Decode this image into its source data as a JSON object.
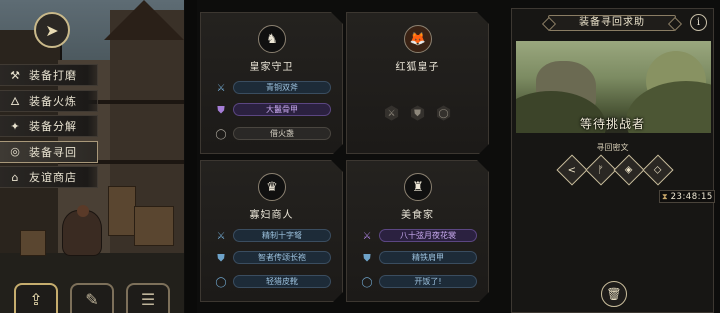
{
  "back_button": {
    "icon": "back-arrow-icon"
  },
  "sidebar": {
    "items": [
      {
        "label": "装备打磨",
        "icon": "hammer-icon",
        "glyph": "⚒",
        "active": false
      },
      {
        "label": "装备火炼",
        "icon": "flame-icon",
        "glyph": "🜂",
        "active": false
      },
      {
        "label": "装备分解",
        "icon": "break-icon",
        "glyph": "✦",
        "active": false
      },
      {
        "label": "装备寻回",
        "icon": "search-icon",
        "glyph": "◎",
        "active": true
      },
      {
        "label": "友谊商店",
        "icon": "shop-icon",
        "glyph": "⌂",
        "active": false
      }
    ]
  },
  "bottom_nav": [
    {
      "icon": "upload-box-icon",
      "glyph": "⇪",
      "active": true
    },
    {
      "icon": "quill-icon",
      "glyph": "✎",
      "active": false
    },
    {
      "icon": "list-icon",
      "glyph": "☰",
      "active": false
    }
  ],
  "cards": [
    {
      "name": "皇家守卫",
      "avatar": "royal-guard-avatar",
      "rows": [
        {
          "label": "青铜双斧",
          "style": "blue",
          "icon": "axe-icon",
          "glyph": "⚔"
        },
        {
          "label": "大鬣骨甲",
          "style": "purple",
          "icon": "armor-icon",
          "glyph": "⛊"
        },
        {
          "label": "借火盏",
          "style": "grey",
          "icon": "ring-icon",
          "glyph": "◯"
        }
      ]
    },
    {
      "name": "红狐皇子",
      "avatar": "red-fox-prince-avatar",
      "rows": [],
      "slots": [
        {
          "icon": "weapon-slot-icon",
          "glyph": "⚔"
        },
        {
          "icon": "armor-slot-icon",
          "glyph": "⛊"
        },
        {
          "icon": "ring-slot-icon",
          "glyph": "◯"
        }
      ]
    },
    {
      "name": "寡妇商人",
      "avatar": "widow-merchant-avatar",
      "rows": [
        {
          "label": "精制十字弩",
          "style": "blue",
          "icon": "crossbow-icon",
          "glyph": "⚔"
        },
        {
          "label": "智者传颂长袍",
          "style": "blue",
          "icon": "robe-icon",
          "glyph": "⛊"
        },
        {
          "label": "轻猎皮靴",
          "style": "blue",
          "icon": "boots-icon",
          "glyph": "◯"
        }
      ]
    },
    {
      "name": "美食家",
      "avatar": "gourmet-avatar",
      "rows": [
        {
          "label": "八十弦月夜花裳",
          "style": "purple",
          "icon": "dagger-icon",
          "glyph": "⚔"
        },
        {
          "label": "精铁肩甲",
          "style": "blue",
          "icon": "pauldron-icon",
          "glyph": "⛊"
        },
        {
          "label": "开饭了!",
          "style": "blue",
          "icon": "ring-icon",
          "glyph": "◯"
        }
      ]
    }
  ],
  "right_panel": {
    "title": "装备寻回求助",
    "info_icon": "info-icon",
    "status": "等待挑战者",
    "ritual_label": "寻回密文",
    "rituals": [
      {
        "icon": "rune-1-icon",
        "glyph": "<"
      },
      {
        "icon": "rune-2-icon",
        "glyph": "ᚠ"
      },
      {
        "icon": "rune-3-icon",
        "glyph": "◈"
      },
      {
        "icon": "rune-4-icon",
        "glyph": "◇"
      }
    ],
    "timer": "23:48:15",
    "timer_icon": "hourglass-icon",
    "trash_icon": "trash-icon"
  }
}
